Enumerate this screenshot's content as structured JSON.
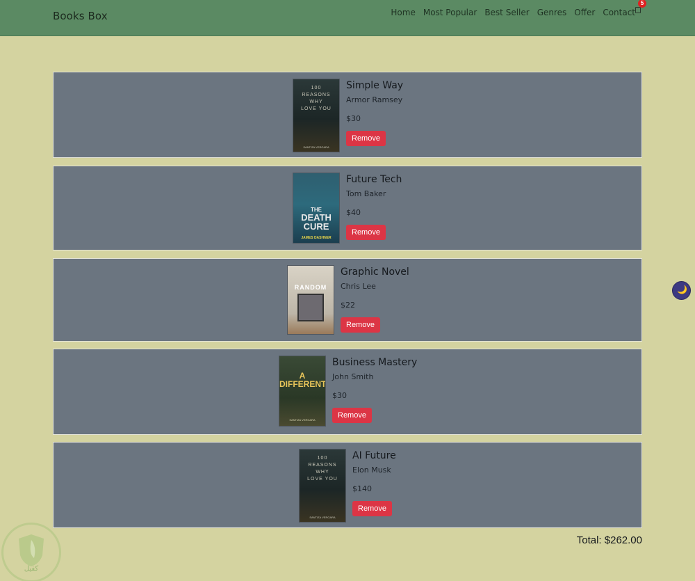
{
  "header": {
    "brand": "Books Box",
    "nav": [
      "Home",
      "Most Popular",
      "Best Seller",
      "Genres",
      "Offer",
      "Contact"
    ],
    "cart_count": "5",
    "cart_icon": "cart-icon"
  },
  "cart": {
    "items": [
      {
        "title": "Simple Way",
        "author": "Armor Ramsey",
        "price": "$30",
        "remove_label": "Remove",
        "cover": {
          "lines": [
            "100",
            "REASONS",
            "WHY",
            "LOVE YOU"
          ],
          "credit": "SANTIZA VERGARA",
          "bg": "#1f2a2a"
        }
      },
      {
        "title": "Future Tech",
        "author": "Tom Baker",
        "price": "$40",
        "remove_label": "Remove",
        "cover": {
          "lines": [
            "THE",
            "DEATH",
            "CURE"
          ],
          "credit": "JAMES DASHNER",
          "bg": "#1e4a5c"
        }
      },
      {
        "title": "Graphic Novel",
        "author": "Chris Lee",
        "price": "$22",
        "remove_label": "Remove",
        "cover": {
          "lines": [
            "RANDOM"
          ],
          "credit": "",
          "bg": "#c8c2b4"
        }
      },
      {
        "title": "Business Mastery",
        "author": "John Smith",
        "price": "$30",
        "remove_label": "Remove",
        "cover": {
          "lines": [
            "A DIFFERENT"
          ],
          "credit": "SANTIZA VERGARA",
          "bg": "#2f3d2c"
        }
      },
      {
        "title": "AI Future",
        "author": "Elon Musk",
        "price": "$140",
        "remove_label": "Remove",
        "cover": {
          "lines": [
            "100",
            "REASONS",
            "WHY",
            "LOVE YOU"
          ],
          "credit": "SANTIZA VERGARA",
          "bg": "#1f2a2a"
        }
      }
    ],
    "total_text": "Total: $262.00"
  },
  "theme_toggle": {
    "icon": "moon-icon",
    "glyph": "🌙"
  },
  "watermark": {
    "text": "كفيل"
  }
}
